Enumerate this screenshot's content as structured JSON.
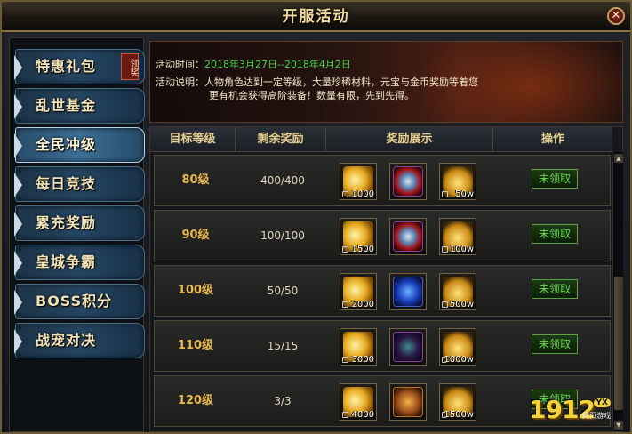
{
  "window": {
    "title": "开服活动",
    "close_glyph": "✕"
  },
  "sidebar": {
    "items": [
      {
        "label": "特惠礼包",
        "badge": "领奖"
      },
      {
        "label": "乱世基金"
      },
      {
        "label": "全民冲级",
        "active": true
      },
      {
        "label": "每日竞技"
      },
      {
        "label": "累充奖励"
      },
      {
        "label": "皇城争霸"
      },
      {
        "label": "BOSS积分"
      },
      {
        "label": "战宠对决"
      }
    ]
  },
  "banner": {
    "time_label": "活动时间：",
    "time_value": "2018年3月27日--2018年4月2日",
    "desc_label": "活动说明：",
    "desc_line1": "人物角色达到一定等级，大量珍稀材料，元宝与金币奖励等着您",
    "desc_line2": "更有机会获得高阶装备！数量有限，先到先得。"
  },
  "table": {
    "headers": [
      "目标等级",
      "剩余奖励",
      "奖励展示",
      "操作"
    ],
    "rows": [
      {
        "level": "80级",
        "remaining": "400/400",
        "rewards": [
          {
            "icon": "gold-ingot-icon",
            "count": "1000"
          },
          {
            "icon": "red-shield-icon",
            "count": ""
          },
          {
            "icon": "gold-coins-icon",
            "count": "50w"
          }
        ],
        "action": "未领取"
      },
      {
        "level": "90级",
        "remaining": "100/100",
        "rewards": [
          {
            "icon": "gold-ingot-icon",
            "count": "1500"
          },
          {
            "icon": "red-shield-icon",
            "count": ""
          },
          {
            "icon": "gold-coins-icon",
            "count": "100w"
          }
        ],
        "action": "未领取"
      },
      {
        "level": "100级",
        "remaining": "50/50",
        "rewards": [
          {
            "icon": "gold-ingot-icon",
            "count": "2000"
          },
          {
            "icon": "blue-egg-icon",
            "count": ""
          },
          {
            "icon": "gold-coins-icon",
            "count": "500w"
          }
        ],
        "action": "未领取"
      },
      {
        "level": "110级",
        "remaining": "15/15",
        "rewards": [
          {
            "icon": "gold-ingot-icon",
            "count": "3000"
          },
          {
            "icon": "purple-egg-icon",
            "count": ""
          },
          {
            "icon": "gold-coins-icon",
            "count": "1000w"
          }
        ],
        "action": "未领取"
      },
      {
        "level": "120级",
        "remaining": "3/3",
        "rewards": [
          {
            "icon": "gold-ingot-icon",
            "count": "4000"
          },
          {
            "icon": "orange-egg-icon",
            "count": ""
          },
          {
            "icon": "gold-coins-icon",
            "count": "1500w"
          }
        ],
        "action": "未领取"
      }
    ]
  },
  "watermark": {
    "brand": "1912",
    "tag": "YX",
    "sub": "网页游戏"
  }
}
